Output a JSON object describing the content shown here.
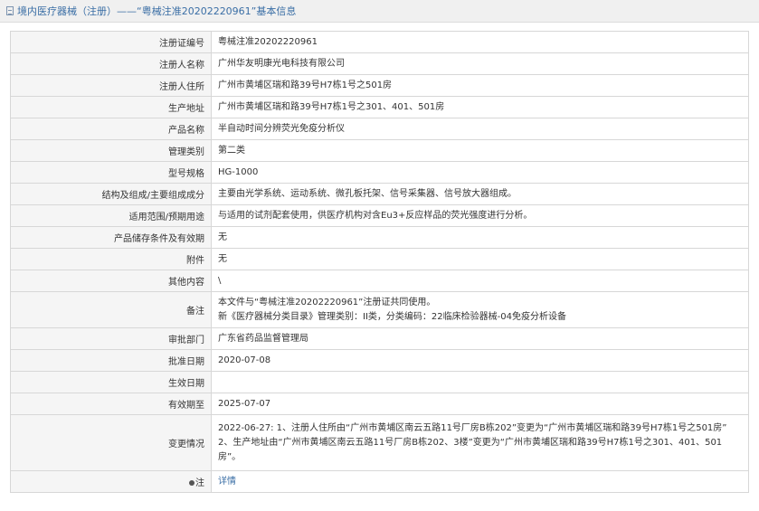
{
  "breadcrumb": "境内医疗器械（注册）——“粤械注准20202220961”基本信息",
  "rows": [
    {
      "label": "注册证编号",
      "value": "粤械注准20202220961"
    },
    {
      "label": "注册人名称",
      "value": "广州华友明康光电科技有限公司"
    },
    {
      "label": "注册人住所",
      "value": "广州市黄埔区瑞和路39号H7栋1号之501房"
    },
    {
      "label": "生产地址",
      "value": "广州市黄埔区瑞和路39号H7栋1号之301、401、501房"
    },
    {
      "label": "产品名称",
      "value": "半自动时间分辨荧光免疫分析仪"
    },
    {
      "label": "管理类别",
      "value": "第二类"
    },
    {
      "label": "型号规格",
      "value": "HG-1000"
    },
    {
      "label": "结构及组成/主要组成成分",
      "value": "主要由光学系统、运动系统、微孔板托架、信号采集器、信号放大器组成。"
    },
    {
      "label": "适用范围/预期用途",
      "value": "与适用的试剂配套使用，供医疗机构对含Eu3+反应样品的荧光强度进行分析。"
    },
    {
      "label": "产品储存条件及有效期",
      "value": "无"
    },
    {
      "label": "附件",
      "value": "无"
    },
    {
      "label": "其他内容",
      "value": "\\"
    },
    {
      "label": "备注",
      "line1": "本文件与“粤械注准20202220961”注册证共同使用。",
      "line2": "新《医疗器械分类目录》管理类别：II类，分类编码：22临床检验器械-04免疫分析设备"
    },
    {
      "label": "审批部门",
      "value": "广东省药品监督管理局"
    },
    {
      "label": "批准日期",
      "value": "2020-07-08"
    },
    {
      "label": "生效日期",
      "value": ""
    },
    {
      "label": "有效期至",
      "value": "2025-07-07"
    },
    {
      "label": "变更情况",
      "line1": "2022-06-27: 1、注册人住所由“广州市黄埔区南云五路11号厂房B栋202”变更为“广州市黄埔区瑞和路39号H7栋1号之501房”",
      "line2": "2、生产地址由“广州市黄埔区南云五路11号厂房B栋202、3楼”变更为“广州市黄埔区瑞和路39号H7栋1号之301、401、501",
      "line3": "房”。"
    },
    {
      "label": "注",
      "value": "详情"
    }
  ]
}
